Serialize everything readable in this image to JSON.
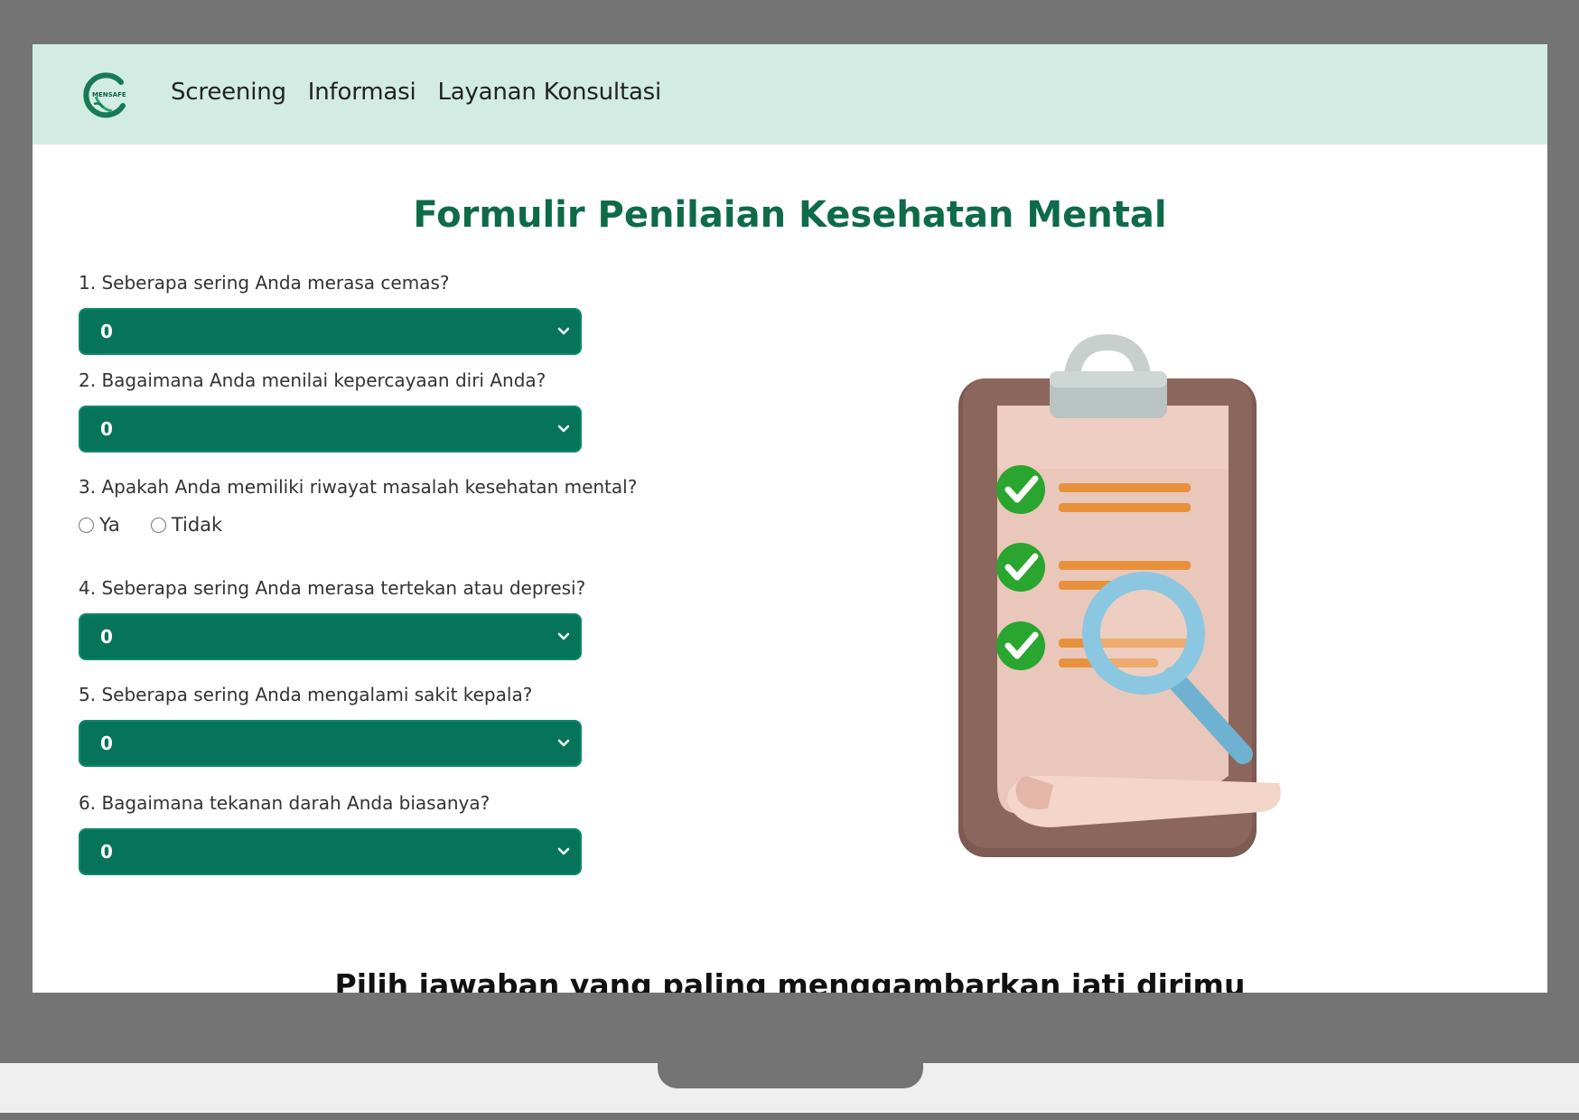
{
  "nav": {
    "items": [
      {
        "label": "Screening"
      },
      {
        "label": "Informasi"
      },
      {
        "label": "Layanan Konsultasi"
      }
    ]
  },
  "page": {
    "title": "Formulir Penilaian Kesehatan Mental",
    "subtitle": "Pilih jawaban yang paling menggambarkan jati dirimu"
  },
  "questions": [
    {
      "label": "1. Seberapa sering Anda merasa cemas?",
      "type": "select",
      "value": "0"
    },
    {
      "label": "2. Bagaimana Anda menilai kepercayaan diri Anda?",
      "type": "select",
      "value": "0"
    },
    {
      "label": "3. Apakah Anda memiliki riwayat masalah kesehatan mental?",
      "type": "radio",
      "options": [
        "Ya",
        "Tidak"
      ]
    },
    {
      "label": "4. Seberapa sering Anda merasa tertekan atau depresi?",
      "type": "select",
      "value": "0"
    },
    {
      "label": "5. Seberapa sering Anda mengalami sakit kepala?",
      "type": "select",
      "value": "0"
    },
    {
      "label": "6. Bagaimana tekanan darah Anda biasanya?",
      "type": "select",
      "value": "0"
    }
  ],
  "colors": {
    "navbar_bg": "#d3ece3",
    "brand_green": "#0e6b48",
    "select_bg": "#06745a",
    "frame": "#747474"
  },
  "icons": {
    "logo": "mensafe-logo",
    "select_arrow": "chevron-down-icon",
    "illustration": "clipboard-checklist-magnifier"
  },
  "logo": {
    "text": "MENSAFE"
  }
}
